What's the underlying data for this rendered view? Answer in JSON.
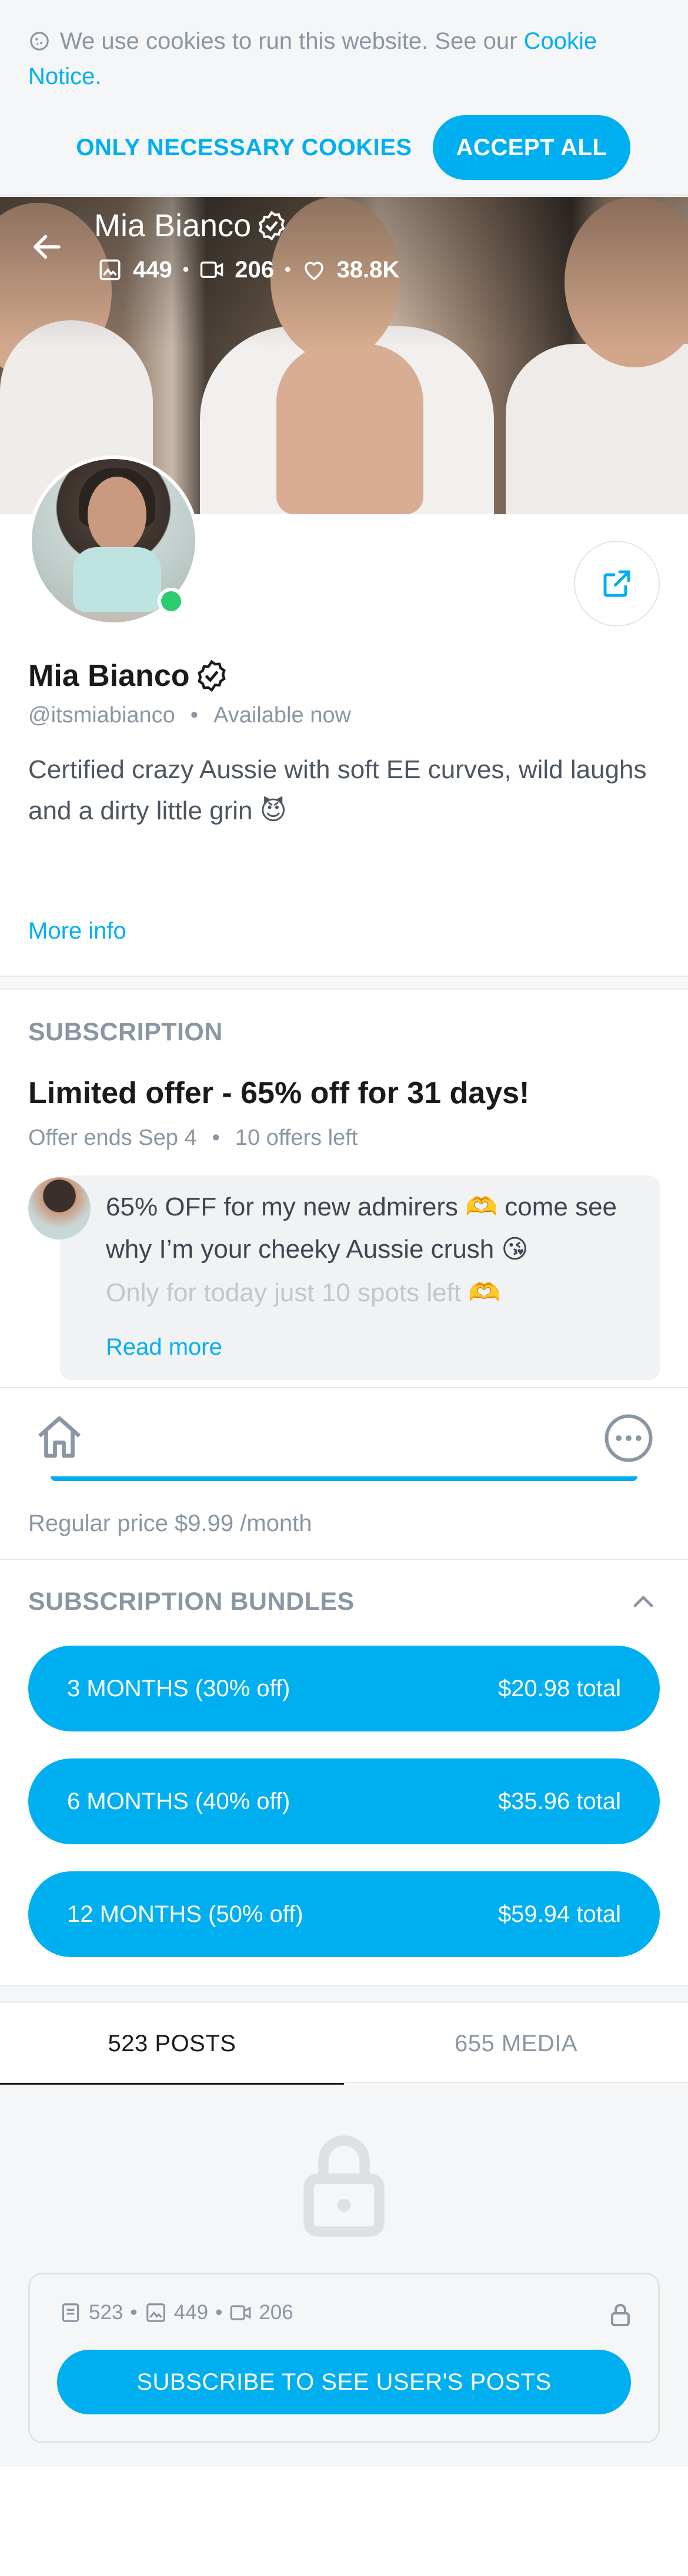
{
  "cookie": {
    "text": "We use cookies to run this website. See our",
    "link": "Cookie Notice",
    "period": ".",
    "necessary_label": "ONLY NECESSARY COOKIES",
    "accept_label": "ACCEPT ALL"
  },
  "header": {
    "name": "Mia Bianco",
    "photos": "449",
    "videos": "206",
    "likes": "38.8K"
  },
  "profile": {
    "name": "Mia Bianco",
    "handle": "@itsmiabianco",
    "status": "Available now",
    "bio": "Certified crazy Aussie with soft EE curves, wild laughs and a dirty little grin 😈",
    "more_info": "More info"
  },
  "subscription": {
    "section_title": "SUBSCRIPTION",
    "offer_title": "Limited offer - 65% off for 31 days!",
    "offer_ends": "Offer ends Sep 4",
    "offers_left": "10 offers left",
    "message_line1": "65% OFF for my new admirers 🫶 come see why I’m your cheeky Aussie crush 😘",
    "message_line2": "Only for today just 10 spots left 🫶",
    "read_more": "Read more",
    "regular_price": "Regular price $9.99 /month"
  },
  "bundles": {
    "section_title": "SUBSCRIPTION BUNDLES",
    "items": [
      {
        "label": "3 MONTHS (30% off)",
        "price": "$20.98 total"
      },
      {
        "label": "6 MONTHS (40% off)",
        "price": "$35.96 total"
      },
      {
        "label": "12 MONTHS (50% off)",
        "price": "$59.94 total"
      }
    ]
  },
  "tabs": {
    "posts": "523 POSTS",
    "media": "655 MEDIA"
  },
  "locked": {
    "posts_count": "523",
    "photos_count": "449",
    "videos_count": "206",
    "subscribe_label": "SUBSCRIBE TO SEE USER'S POSTS"
  },
  "colors": {
    "accent": "#00aff0",
    "online": "#2ecc71",
    "muted": "#8a96a3"
  }
}
